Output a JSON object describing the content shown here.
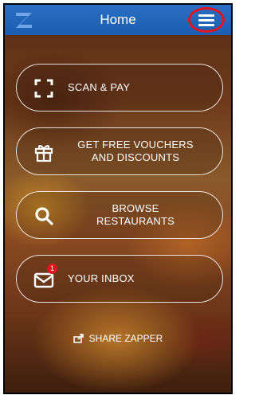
{
  "header": {
    "title": "Home"
  },
  "menu": {
    "scan": {
      "label": "SCAN & PAY"
    },
    "vouchers": {
      "label_line1": "GET FREE VOUCHERS",
      "label_line2": "AND DISCOUNTS"
    },
    "browse": {
      "label_line1": "BROWSE",
      "label_line2": "RESTAURANTS"
    },
    "inbox": {
      "label": "YOUR INBOX",
      "badge": "1"
    }
  },
  "footer": {
    "share_label": "SHARE ZAPPER"
  },
  "icons": {
    "logo": "zapper-logo",
    "menu": "hamburger-icon",
    "scan": "scan-frame-icon",
    "vouchers": "gift-icon",
    "browse": "search-icon",
    "inbox": "mail-icon",
    "share": "share-icon"
  },
  "colors": {
    "header_blue": "#1b5db0",
    "highlight_red": "#e0151f",
    "text_white": "#ffffff"
  }
}
